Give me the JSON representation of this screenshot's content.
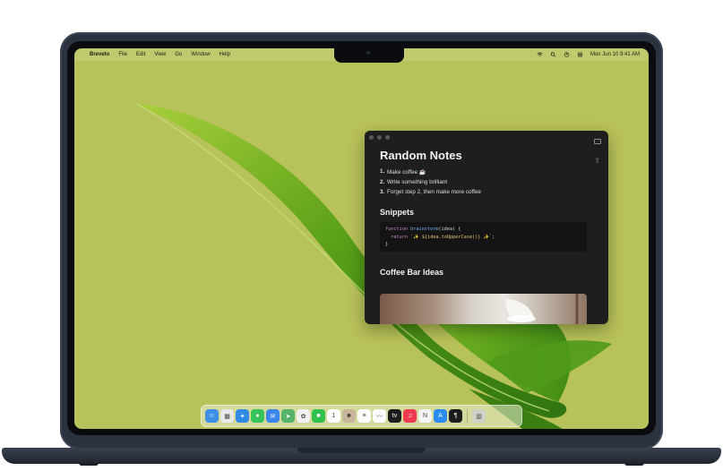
{
  "menubar": {
    "apple": "",
    "app_name": "Breveto",
    "items": [
      "File",
      "Edit",
      "View",
      "Go",
      "Window",
      "Help"
    ],
    "datetime": "Mon Jun 10  9:41 AM"
  },
  "notes": {
    "title": "Random Notes",
    "list": [
      {
        "num": "1.",
        "text": "Make coffee ☕"
      },
      {
        "num": "2.",
        "text": "Write something brilliant"
      },
      {
        "num": "3.",
        "text": "Forget step 2, then make more coffee"
      }
    ],
    "snippets_heading": "Snippets",
    "code": {
      "line1_kw": "function",
      "line1_fn": "brainstorm",
      "line1_rest": "(idea) {",
      "line2_kw": "return",
      "line2_str": "`✨ ${idea.toUpperCase()} ✨`",
      "line2_end": ";",
      "line3": "}"
    },
    "coffee_heading": "Coffee Bar Ideas"
  },
  "dock": {
    "apps": [
      {
        "name": "finder-icon",
        "color": "#3d8fe8",
        "glyph": "☺"
      },
      {
        "name": "launchpad-icon",
        "color": "#e8e8e8",
        "glyph": "▦"
      },
      {
        "name": "safari-icon",
        "color": "#2f8be6",
        "glyph": "✦"
      },
      {
        "name": "messages-icon",
        "color": "#36c45a",
        "glyph": "●"
      },
      {
        "name": "mail-icon",
        "color": "#3a86f0",
        "glyph": "✉"
      },
      {
        "name": "maps-icon",
        "color": "#56b36a",
        "glyph": "➤"
      },
      {
        "name": "photos-icon",
        "color": "#f2f2f2",
        "glyph": "✿"
      },
      {
        "name": "facetime-icon",
        "color": "#30c14f",
        "glyph": "■"
      },
      {
        "name": "calendar-icon",
        "color": "#ffffff",
        "glyph": "1"
      },
      {
        "name": "contacts-icon",
        "color": "#c9b69a",
        "glyph": "☻"
      },
      {
        "name": "reminders-icon",
        "color": "#ffffff",
        "glyph": "≡"
      },
      {
        "name": "freeform-icon",
        "color": "#ffffff",
        "glyph": "〰"
      },
      {
        "name": "tv-icon",
        "color": "#1c1c1c",
        "glyph": "tv"
      },
      {
        "name": "music-icon",
        "color": "#f23b52",
        "glyph": "♫"
      },
      {
        "name": "news-icon",
        "color": "#f4f4f4",
        "glyph": "N"
      },
      {
        "name": "app-store-icon",
        "color": "#2b8cf0",
        "glyph": "A"
      },
      {
        "name": "breveto-icon",
        "color": "#1c1c1c",
        "glyph": "¶"
      }
    ],
    "trash": {
      "name": "trash-icon",
      "color": "#cfd2c8",
      "glyph": "▥"
    }
  }
}
